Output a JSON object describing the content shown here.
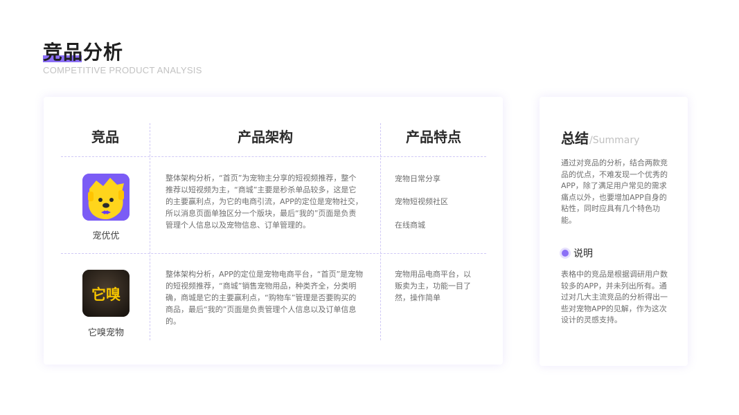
{
  "header": {
    "title": "竞品分析",
    "subtitle": "COMPETITIVE PRODUCT ANALYSIS"
  },
  "table": {
    "headers": [
      "竞品",
      "产品架构",
      "产品特点"
    ],
    "rows": [
      {
        "app_name": "宠优优",
        "icon": "yellow-dog-icon",
        "description": "整体架构分析，“首页”为宠物主分享的短视频推荐，整个推荐以短视频为主，“商城”主要是秒杀单品较多，这是它的主要赢利点，为它的电商引流，APP的定位是宠物社交，所以消息页面单独区分一个版块，最后“我的”页面是负责管理个人信息以及宠物信息、订单管理的。",
        "features": [
          "宠物日常分享",
          "宠物短视频社区",
          "在线商城"
        ]
      },
      {
        "app_name": "它嗅宠物",
        "icon": "taxiu-logo-icon",
        "icon_text": "它嗅",
        "description": "整体架构分析，APP的定位是宠物电商平台，“首页”是宠物的短视频推荐，“商城”销售宠物用品，种类齐全，分类明确，商城是它的主要赢利点，“购物车”管理是否要购买的商品，最后“我的”页面是负责管理个人信息以及订单信息的。",
        "features": [
          "宠物用品电商平台，以贩卖为主，功能一目了然，操作简单"
        ]
      }
    ]
  },
  "summary": {
    "title": "总结",
    "title_en": "/Summary",
    "text": "通过对竞品的分析，结合两款竞品的优点，不难发现一个优秀的APP，除了满足用户常见的需求痛点以外，也要增加APP自身的粘性，同时应具有几个特色功能。",
    "note_label": "说明",
    "note_text": "表格中的竞品是根据调研用户数较多的APP，并未列出所有。通过对几大主流竞品的分析得出一些对宠物APP的见解，作为这次设计的灵感支持。"
  },
  "colors": {
    "accent": "#8b6ff6",
    "divider": "#cfc8f5",
    "icon1_bg": "#7b5cf5",
    "icon1_dog": "#ffd51c",
    "icon2_bg": "#2b241c",
    "icon2_text": "#f5c400"
  }
}
